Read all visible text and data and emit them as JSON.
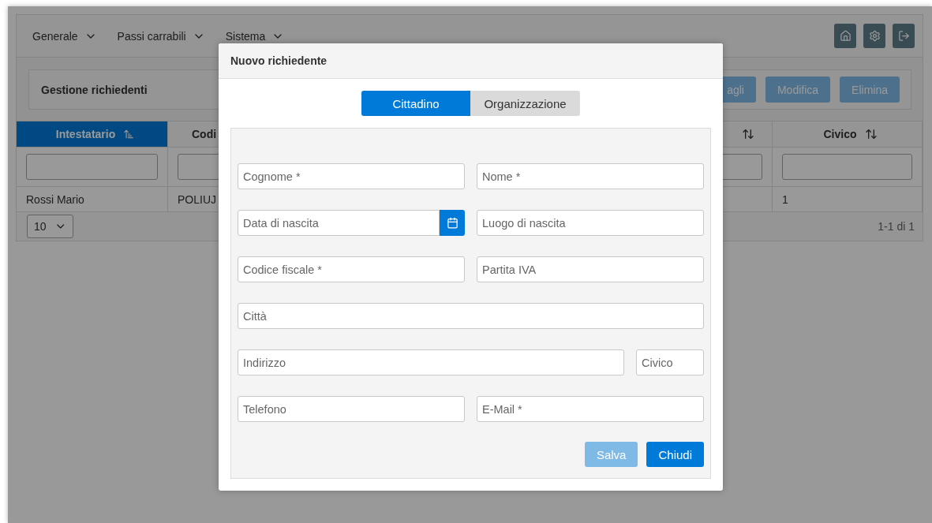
{
  "nav": {
    "menus": [
      {
        "label": "Generale"
      },
      {
        "label": "Passi carrabili"
      },
      {
        "label": "Sistema"
      }
    ]
  },
  "panel": {
    "title": "Gestione richiedenti",
    "actions": [
      {
        "label": "agli",
        "disabled": true
      },
      {
        "label": "Modifica",
        "disabled": true
      },
      {
        "label": "Elimina",
        "disabled": true
      }
    ]
  },
  "table": {
    "columns": [
      {
        "label": "Intestatario",
        "sorted": true
      },
      {
        "label": "Codi",
        "sorted": false
      },
      {
        "sorted": false
      },
      {
        "label": "Civico",
        "sorted": false
      }
    ],
    "rows": [
      {
        "intestatario": "Rossi Mario",
        "column_2": "POLIUJ",
        "civico": "1"
      }
    ],
    "paginator": {
      "rows_per_page": "10",
      "summary": "1-1 di 1"
    }
  },
  "dialog": {
    "title": "Nuovo richiedente",
    "tabs": [
      {
        "label": "Cittadino",
        "selected": true
      },
      {
        "label": "Organizzazione",
        "selected": false
      }
    ],
    "rows": [
      {
        "fields": [
          {
            "kind": "text",
            "placeholder": "Cognome *"
          },
          {
            "kind": "text",
            "placeholder": "Nome *"
          }
        ]
      },
      {
        "fields": [
          {
            "kind": "date",
            "placeholder": "Data di nascita"
          },
          {
            "kind": "text",
            "placeholder": "Luogo di nascita"
          }
        ]
      },
      {
        "fields": [
          {
            "kind": "text",
            "placeholder": "Codice fiscale *"
          },
          {
            "kind": "text",
            "placeholder": "Partita IVA"
          }
        ]
      },
      {
        "fields": [
          {
            "kind": "text",
            "placeholder": "Città"
          }
        ]
      },
      {
        "fields": [
          {
            "kind": "text",
            "placeholder": "Indirizzo"
          },
          {
            "kind": "short",
            "placeholder": "Civico"
          }
        ]
      },
      {
        "fields": [
          {
            "kind": "text",
            "placeholder": "Telefono"
          },
          {
            "kind": "text",
            "placeholder": "E-Mail *"
          }
        ]
      }
    ],
    "buttons": [
      {
        "label": "Salva",
        "disabled": true
      },
      {
        "label": "Chiudi",
        "disabled": false
      }
    ]
  }
}
